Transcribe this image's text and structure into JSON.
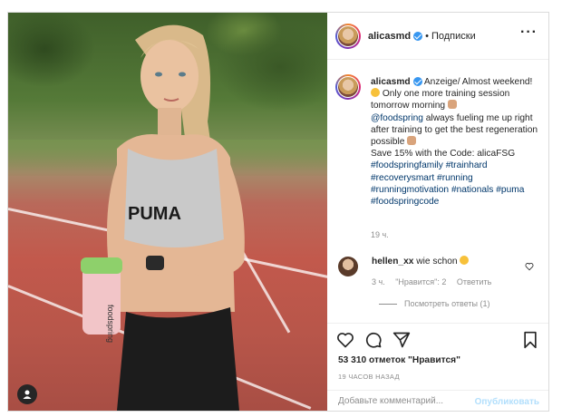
{
  "post": {
    "author": {
      "username": "alicasmd",
      "verified": true,
      "follow_state": "Подписки",
      "separator": "•"
    },
    "more_icon": "ellipsis-icon",
    "caption": {
      "username": "alicasmd",
      "line1": "Anzeige/ Almost weekend!",
      "line2": "Only one more training session tomorrow morning",
      "mention": "@foodspring",
      "line3": "always fueling me up right after training to get the best regeneration possible",
      "line4": "Save 15% with the Code: alicaFSG",
      "hashtags": [
        "#foodspringfamily",
        "#trainhard",
        "#recoverysmart",
        "#running",
        "#runningmotivation",
        "#nationals",
        "#puma",
        "#foodspringcode"
      ],
      "time": "19 ч."
    },
    "comments": [
      {
        "username": "hellen_xx",
        "text": "wie schon",
        "time": "3 ч.",
        "likes": "\"Нравится\": 2",
        "reply_label": "Ответить",
        "view_replies": "Посмотреть ответы (1)"
      }
    ],
    "likes": "53 310 отметок \"Нравится\"",
    "time_ago": "19 ЧАСОВ НАЗАД",
    "add_comment_placeholder": "Добавьте комментарий...",
    "publish_label": "Опубликовать",
    "photo": {
      "shirt_text": "PUMA",
      "bottle_text": "foodspring"
    }
  },
  "colors": {
    "link": "#00376b",
    "muted": "#8e8e8e",
    "publish_disabled": "#b2dffc",
    "verified": "#3897f0",
    "border": "#dbdbdb"
  }
}
